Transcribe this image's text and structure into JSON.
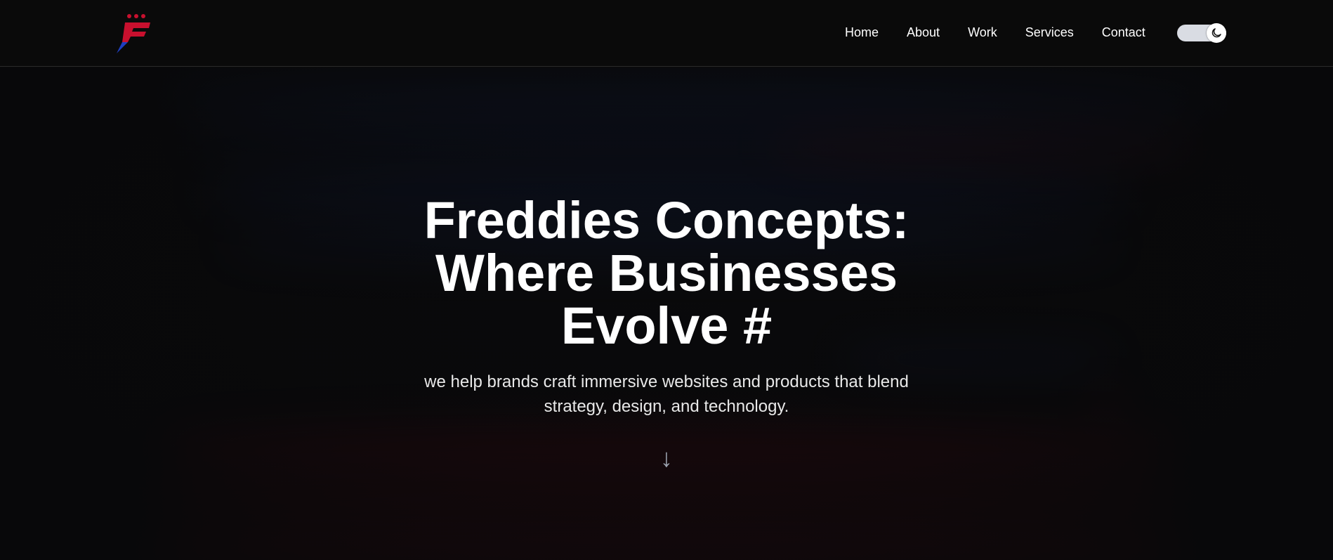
{
  "brand": {
    "logo_icon": "freddies-concepts-logo-icon",
    "colors": {
      "red": "#c8102e",
      "blue": "#1f3fbf"
    }
  },
  "nav": {
    "items": [
      {
        "label": "Home"
      },
      {
        "label": "About"
      },
      {
        "label": "Work"
      },
      {
        "label": "Services"
      },
      {
        "label": "Contact"
      }
    ],
    "theme_toggle": {
      "icon": "moon-icon",
      "state": "dark"
    }
  },
  "hero": {
    "title": "Freddies Concepts: Where Businesses Evolve #",
    "subtitle": "we help brands craft immersive websites and products that blend strategy, design, and technology.",
    "scroll_icon": "↓"
  },
  "colors": {
    "background": "#0a0a0a",
    "text": "#ffffff",
    "toggle_track": "#d9dce3"
  }
}
